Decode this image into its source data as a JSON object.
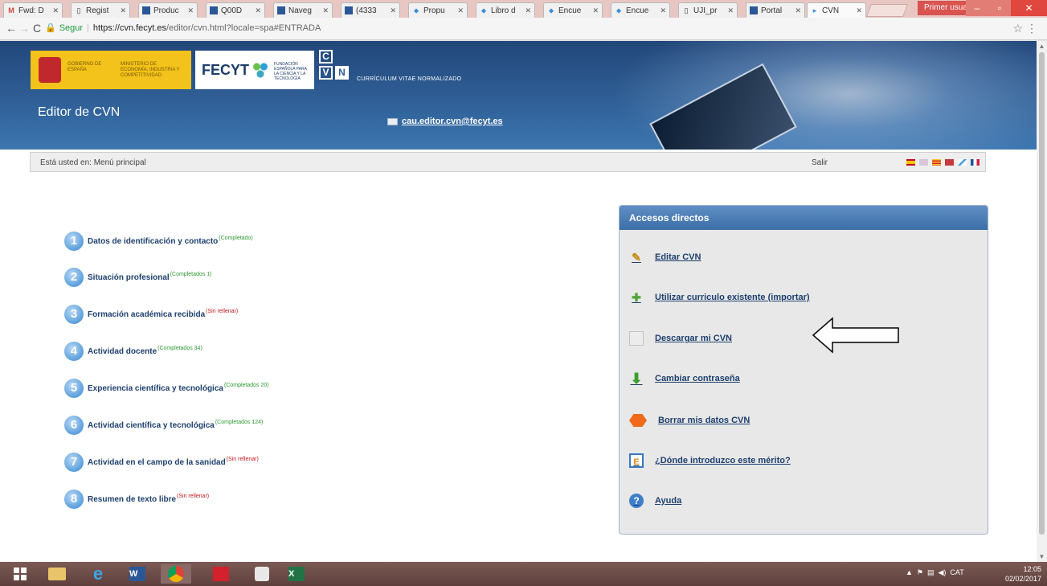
{
  "browser": {
    "tabs": [
      {
        "label": "Fwd: D",
        "icon": "gmail-icon"
      },
      {
        "label": "Regist",
        "icon": "page-icon"
      },
      {
        "label": "Produc",
        "icon": "fecyt-icon"
      },
      {
        "label": "Q00D",
        "icon": "fecyt-icon"
      },
      {
        "label": "Naveg",
        "icon": "fecyt-icon"
      },
      {
        "label": "(4333",
        "icon": "mail-icon"
      },
      {
        "label": "Propu",
        "icon": "pin-icon"
      },
      {
        "label": "Libro d",
        "icon": "pin-icon"
      },
      {
        "label": "Encue",
        "icon": "pin-icon"
      },
      {
        "label": "Encue",
        "icon": "pin-icon"
      },
      {
        "label": "UJI_pr",
        "icon": "page-icon"
      },
      {
        "label": "Portal",
        "icon": "fecyt-icon"
      },
      {
        "label": "CVN",
        "icon": "cvn-icon"
      }
    ],
    "user_badge": "Primer usuario",
    "url": {
      "secure_label": "Segur",
      "host": "https://cvn.fecyt.es",
      "path": "/editor/cvn.html?locale=spa#ENTRADA"
    }
  },
  "header": {
    "gov_text_1": "GOBIERNO DE ESPAÑA",
    "gov_text_2": "MINISTERIO DE ECONOMÍA, INDUSTRIA Y COMPETITIVIDAD",
    "fecyt_label": "FECYT",
    "fecyt_sub": "FUNDACIÓN ESPAÑOLA PARA LA CIENCIA Y LA TECNOLOGÍA",
    "cvn_letters": [
      "C",
      "V",
      "N"
    ],
    "cvn_tag": "CURRÍCULUM VITAE NORMALIZADO",
    "app_title": "Editor de CVN",
    "contact_email": "cau.editor.cvn@fecyt.es"
  },
  "breadcrumb": {
    "text": "Está usted en: Menú principal",
    "logout": "Salir"
  },
  "menu": [
    {
      "num": "1",
      "label": "Datos de identificación y contacto",
      "status": "(Completado)",
      "state": "done"
    },
    {
      "num": "2",
      "label": "Situación profesional",
      "status": "(Completados 1)",
      "state": "done"
    },
    {
      "num": "3",
      "label": "Formación académica recibida",
      "status": "(Sin rellenar)",
      "state": "empty"
    },
    {
      "num": "4",
      "label": "Actividad docente",
      "status": "(Completados 34)",
      "state": "done"
    },
    {
      "num": "5",
      "label": "Experiencia científica y tecnológica",
      "status": "(Completados 20)",
      "state": "done"
    },
    {
      "num": "6",
      "label": "Actividad científica y tecnológica",
      "status": "(Completados 124)",
      "state": "done"
    },
    {
      "num": "7",
      "label": "Actividad en el campo de la sanidad",
      "status": "(Sin rellenar)",
      "state": "empty"
    },
    {
      "num": "8",
      "label": "Resumen de texto libre",
      "status": "(Sin rellenar)",
      "state": "empty"
    }
  ],
  "direct_access": {
    "title": "Accesos directos",
    "items": [
      {
        "label": "Editar CVN",
        "icon": "pencil-icon"
      },
      {
        "label": "Utilizar curriculo existente (importar)",
        "icon": "import-icon"
      },
      {
        "label": "Descargar mi CVN",
        "icon": "document-icon"
      },
      {
        "label": "Cambiar contraseña",
        "icon": "download-arrow-icon"
      },
      {
        "label": "Borrar mis datos CVN",
        "icon": "delete-octagon-icon"
      },
      {
        "label": "¿Dónde introduzco este mérito?",
        "icon": "where-icon"
      },
      {
        "label": "Ayuda",
        "icon": "help-icon"
      }
    ]
  },
  "taskbar": {
    "tray_lang": "CAT",
    "time": "12:05",
    "date": "02/02/2017"
  },
  "colors": {
    "banner": "#2f5f96",
    "menu_text": "#1d3f6e",
    "status_done": "#2d9a33",
    "status_empty": "#c4161c",
    "panel_head": "#4a7db5"
  }
}
